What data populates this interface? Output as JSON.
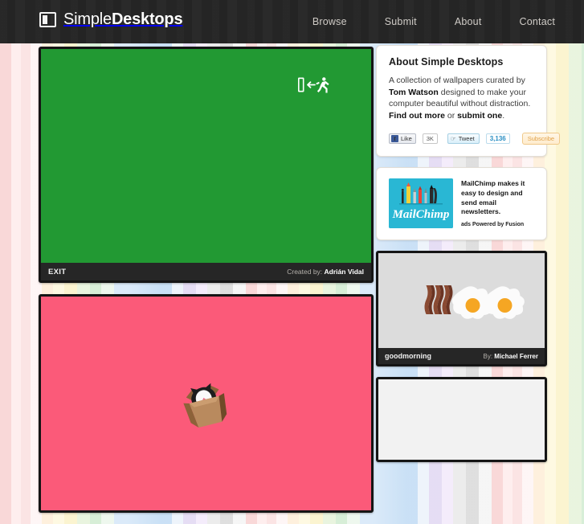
{
  "site": {
    "logo_light": "Simple",
    "logo_bold": "Desktops",
    "logo_icon": "monitor-icon"
  },
  "nav": {
    "items": [
      {
        "label": "Browse"
      },
      {
        "label": "Submit"
      },
      {
        "label": "About"
      },
      {
        "label": "Contact"
      }
    ]
  },
  "main": {
    "wallpapers": [
      {
        "title": "EXIT",
        "by_label": "Created by:",
        "author": "Adrián Vidal",
        "art": "emergency-exit-sign",
        "bg_color": "#229933"
      },
      {
        "title": "",
        "by_label": "",
        "author": "",
        "art": "cat-in-box",
        "bg_color": "#fb5a79"
      }
    ]
  },
  "sidebar": {
    "about": {
      "heading": "About Simple Desktops",
      "text_1": "A collection of wallpapers curated by ",
      "text_author": "Tom Watson",
      "text_2": " designed to make your computer beautiful without distraction. ",
      "link_find": "Find out more",
      "text_or": " or ",
      "link_submit": "submit one",
      "text_end": "."
    },
    "social": {
      "facebook_label": "Like",
      "facebook_glyph": "f",
      "facebook_count": "3K",
      "twitter_label": "Tweet",
      "twitter_count": "3,136",
      "subscribe_label": "Subscribe"
    },
    "ad": {
      "logo_text": "MailChimp",
      "copy": "MailChimp makes it easy to design and send email newsletters.",
      "powered": "ads Powered by Fusion",
      "logo_bg": "#29b7d4"
    },
    "thumbs": [
      {
        "title": "goodmorning",
        "by_label": "By:",
        "author": "Michael Ferrer",
        "art": "bacon-and-eggs",
        "bg_color": "#dcdcdc"
      },
      {
        "title": "",
        "by_label": "",
        "author": "",
        "art": "blank",
        "bg_color": "#f2f2f2"
      }
    ]
  }
}
